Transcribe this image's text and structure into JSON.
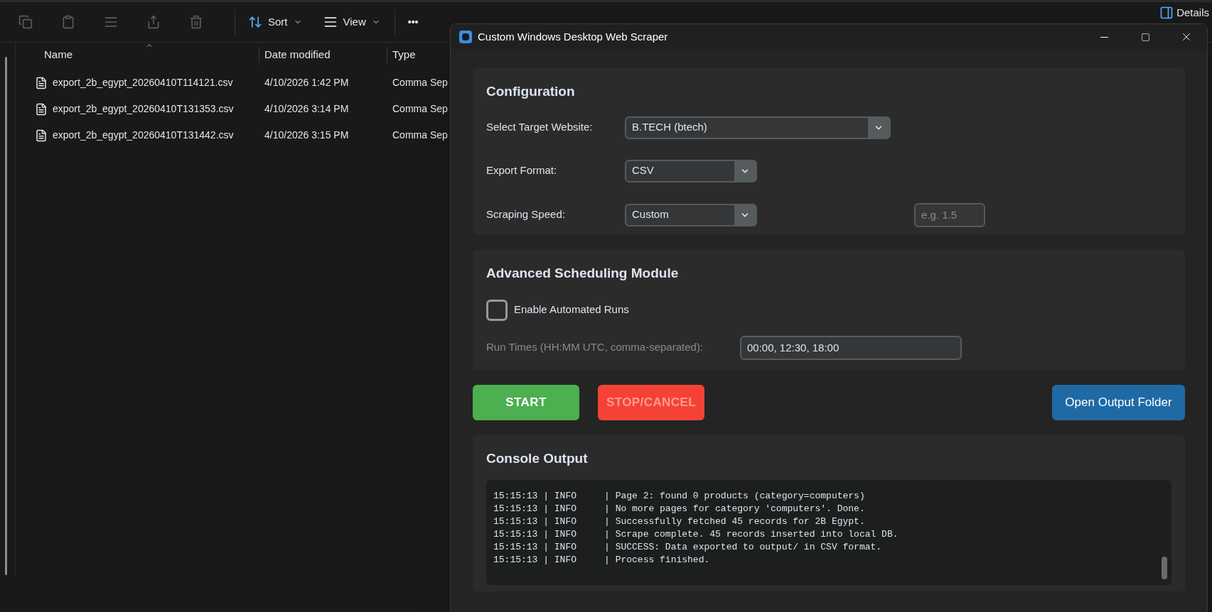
{
  "explorer": {
    "toolbar": {
      "sort": "Sort",
      "view": "View",
      "more": "•••",
      "details": "Details"
    },
    "columns": [
      "Name",
      "Date modified",
      "Type"
    ],
    "files": [
      {
        "name": "export_2b_egypt_20260410T114121.csv",
        "date": "4/10/2026 1:42 PM",
        "type": "Comma Sep"
      },
      {
        "name": "export_2b_egypt_20260410T131353.csv",
        "date": "4/10/2026 3:14 PM",
        "type": "Comma Sep"
      },
      {
        "name": "export_2b_egypt_20260410T131442.csv",
        "date": "4/10/2026 3:15 PM",
        "type": "Comma Sep"
      }
    ]
  },
  "window": {
    "title": "Custom Windows Desktop Web Scraper"
  },
  "configuration": {
    "title": "Configuration",
    "target_label": "Select Target Website:",
    "target_value": "B.TECH (btech)",
    "format_label": "Export Format:",
    "format_value": "CSV",
    "speed_label": "Scraping Speed:",
    "speed_value": "Custom",
    "speed_placeholder": "e.g. 1.5"
  },
  "scheduling": {
    "title": "Advanced Scheduling Module",
    "enable_label": "Enable Automated Runs",
    "enable_checked": false,
    "times_label": "Run Times (HH:MM UTC, comma-separated):",
    "times_value": "00:00, 12:30, 18:00"
  },
  "buttons": [
    {
      "label": "START",
      "kind": "start"
    },
    {
      "label": "STOP/CANCEL",
      "kind": "stop"
    },
    {
      "label": "Open Output Folder",
      "kind": "folder"
    }
  ],
  "console": {
    "title": "Console Output",
    "separator": "|",
    "lines": [
      {
        "time": "15:15:13",
        "level": "INFO",
        "message": "Page 2: found 0 products (category=computers)"
      },
      {
        "time": "15:15:13",
        "level": "INFO",
        "message": "No more pages for category 'computers'. Done."
      },
      {
        "time": "15:15:13",
        "level": "INFO",
        "message": "Successfully fetched 45 records for 2B Egypt."
      },
      {
        "time": "15:15:13",
        "level": "INFO",
        "message": "Scrape complete. 45 records inserted into local DB."
      },
      {
        "time": "15:15:13",
        "level": "INFO",
        "message": "SUCCESS: Data exported to output/ in CSV format."
      },
      {
        "time": "15:15:13",
        "level": "INFO",
        "message": "Process finished."
      }
    ]
  }
}
